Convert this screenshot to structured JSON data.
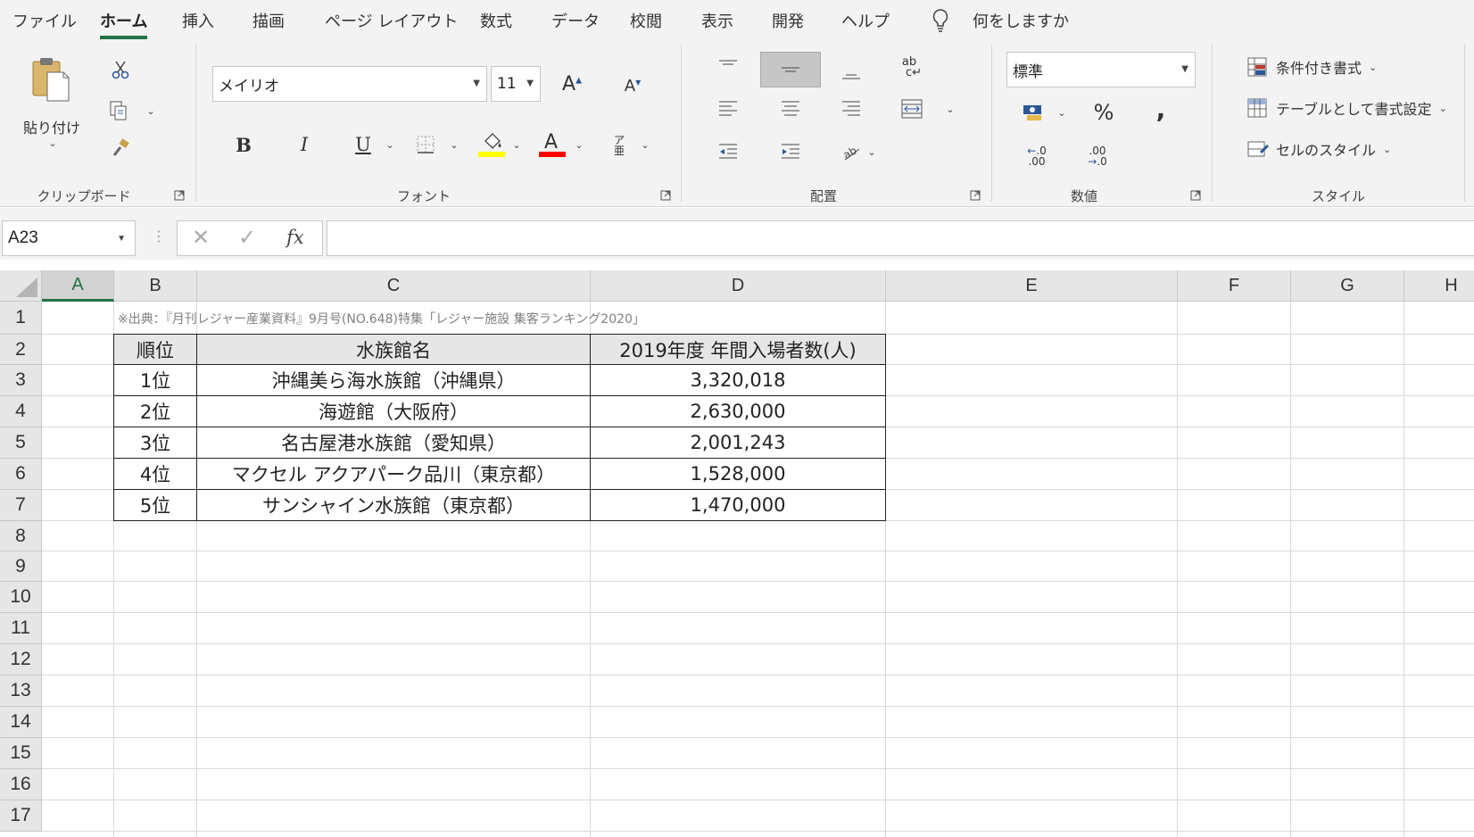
{
  "tabs": [
    "ファイル",
    "ホーム",
    "挿入",
    "描画",
    "ページ レイアウト",
    "数式",
    "データ",
    "校閲",
    "表示",
    "開発",
    "ヘルプ"
  ],
  "tell_me": "何をしますか",
  "ribbon": {
    "clipboard": {
      "paste_label": "貼り付け",
      "group_label": "クリップボード"
    },
    "font": {
      "font_name": "メイリオ",
      "font_size": "11",
      "group_label": "フォント"
    },
    "alignment": {
      "group_label": "配置"
    },
    "number": {
      "format": "標準",
      "percent": "%",
      "comma": ",",
      "group_label": "数値"
    },
    "styles": {
      "conditional": "条件付き書式",
      "table": "テーブルとして書式設定",
      "cell_styles": "セルのスタイル",
      "group_label": "スタイル"
    }
  },
  "formula_bar": {
    "name_box": "A23",
    "fx": "fx",
    "value": ""
  },
  "columns": [
    "A",
    "B",
    "C",
    "D",
    "E",
    "F",
    "G",
    "H"
  ],
  "rows": [
    "1",
    "2",
    "3",
    "4",
    "5",
    "6",
    "7",
    "8",
    "9",
    "10",
    "11",
    "12",
    "13",
    "14",
    "15",
    "16",
    "17"
  ],
  "sheet": {
    "note": "※出典：『月刊レジャー産業資料』9月号(NO.648)特集「レジャー施設 集客ランキング2020」",
    "header": [
      "順位",
      "水族館名",
      "2019年度 年間入場者数(人)"
    ],
    "data": [
      [
        "1位",
        "沖縄美ら海水族館（沖縄県）",
        "3,320,018"
      ],
      [
        "2位",
        "海遊館（大阪府）",
        "2,630,000"
      ],
      [
        "3位",
        "名古屋港水族館（愛知県）",
        "2,001,243"
      ],
      [
        "4位",
        "マクセル アクアパーク品川（東京都）",
        "1,528,000"
      ],
      [
        "5位",
        "サンシャイン水族館（東京都）",
        "1,470,000"
      ]
    ]
  },
  "colors": {
    "accent": "#217346",
    "highlight": "#ffff00",
    "font_color": "#ff0000"
  }
}
